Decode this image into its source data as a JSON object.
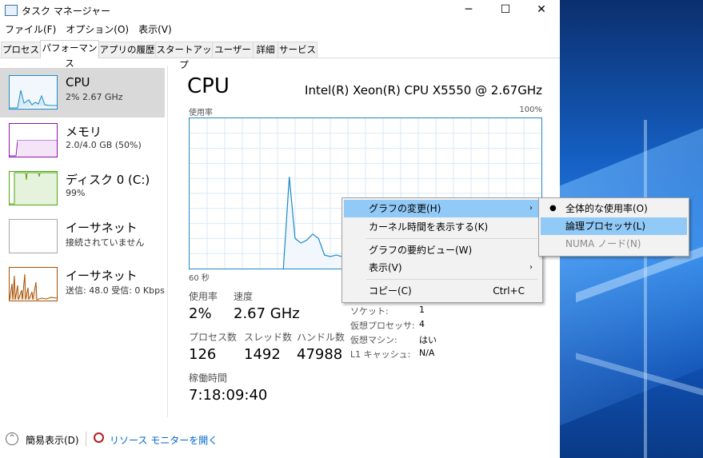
{
  "window": {
    "title": "タスク マネージャー",
    "controls": {
      "minimize": "─",
      "maximize": "☐",
      "close": "✕"
    }
  },
  "menubar": [
    "ファイル(F)",
    "オプション(O)",
    "表示(V)"
  ],
  "tabs": [
    "プロセス",
    "パフォーマンス",
    "アプリの履歴",
    "スタートアップ",
    "ユーザー",
    "詳細",
    "サービス"
  ],
  "active_tab": "パフォーマンス",
  "sidebar": {
    "items": [
      {
        "name": "CPU",
        "detail": "2%  2.67 GHz",
        "color": "#1d8ac8"
      },
      {
        "name": "メモリ",
        "detail": "2.0/4.0 GB (50%)",
        "color": "#8b12ae"
      },
      {
        "name": "ディスク 0 (C:)",
        "detail": "99%",
        "color": "#4da60c"
      },
      {
        "name": "イーサネット",
        "detail": "接続されていません",
        "color": "#a7a7a7"
      },
      {
        "name": "イーサネット",
        "detail": "送信: 48.0 受信: 0 Kbps",
        "color": "#a74f01"
      }
    ]
  },
  "main": {
    "title": "CPU",
    "model": "Intel(R) Xeon(R) CPU X5550 @ 2.67GHz",
    "graph_label": "使用率",
    "graph_max": "100%",
    "graph_time": "60 秒"
  },
  "chart_data": {
    "type": "area",
    "title": "CPU",
    "ylabel": "使用率",
    "xlabel": "60 秒",
    "ylim": [
      0,
      100
    ],
    "color": "#1d8ac8",
    "x": [
      0,
      1,
      2,
      3,
      4,
      5,
      6,
      7,
      8,
      9,
      10,
      11,
      12,
      13,
      14,
      15,
      16,
      17,
      18,
      19,
      20,
      21,
      22,
      23,
      24,
      25,
      26,
      27,
      28,
      29,
      30,
      31,
      32,
      33,
      34,
      35,
      36,
      37,
      38,
      39,
      40,
      41,
      42,
      43,
      44,
      45,
      46,
      47,
      48,
      49,
      50,
      51,
      52,
      53,
      54,
      55,
      56,
      57,
      58,
      59,
      60
    ],
    "values": [
      0,
      0,
      0,
      0,
      0,
      0,
      0,
      0,
      0,
      0,
      0,
      0,
      0,
      0,
      0,
      0,
      0,
      61,
      20,
      17,
      19,
      23,
      20,
      9,
      8,
      9,
      8,
      11,
      6,
      9,
      13,
      20,
      15,
      38,
      16,
      16,
      17,
      14,
      16,
      47,
      13,
      12,
      30,
      10,
      11,
      11,
      12,
      11,
      13,
      11,
      10,
      14,
      18,
      11,
      12,
      10,
      12,
      12,
      12,
      12,
      12
    ]
  },
  "stats": {
    "usage": {
      "label": "使用率",
      "value": "2%"
    },
    "speed": {
      "label": "速度",
      "value": "2.67 GHz"
    },
    "processes": {
      "label": "プロセス数",
      "value": "126"
    },
    "threads": {
      "label": "スレッド数",
      "value": "1492"
    },
    "handles": {
      "label": "ハンドル数",
      "value": "47988"
    },
    "uptime": {
      "label": "稼働時間",
      "value": "7:18:09:40"
    }
  },
  "info": [
    {
      "label": "ソケット:",
      "value": "1"
    },
    {
      "label": "仮想プロセッサ:",
      "value": "4"
    },
    {
      "label": "仮想マシン:",
      "value": "はい"
    },
    {
      "label": "L1 キャッシュ:",
      "value": "N/A"
    }
  ],
  "footer": {
    "fewer_details": "簡易表示(D)",
    "fewer_details_icon": "^",
    "resource_monitor": "リソース モニターを開く"
  },
  "context_menu": {
    "items": [
      {
        "label": "グラフの変更(H)",
        "submenu": true,
        "highlighted": true
      },
      {
        "label": "カーネル時間を表示する(K)"
      },
      {
        "label": "グラフの要約ビュー(W)"
      },
      {
        "label": "表示(V)",
        "submenu": true
      },
      {
        "label": "コピー(C)",
        "shortcut": "Ctrl+C"
      }
    ],
    "arrow": "›"
  },
  "submenu": {
    "bullet": "●",
    "items": [
      {
        "label": "全体的な使用率(O)",
        "checked": true
      },
      {
        "label": "論理プロセッサ(L)",
        "highlighted": true
      },
      {
        "label": "NUMA ノード(N)",
        "disabled": true
      }
    ]
  }
}
